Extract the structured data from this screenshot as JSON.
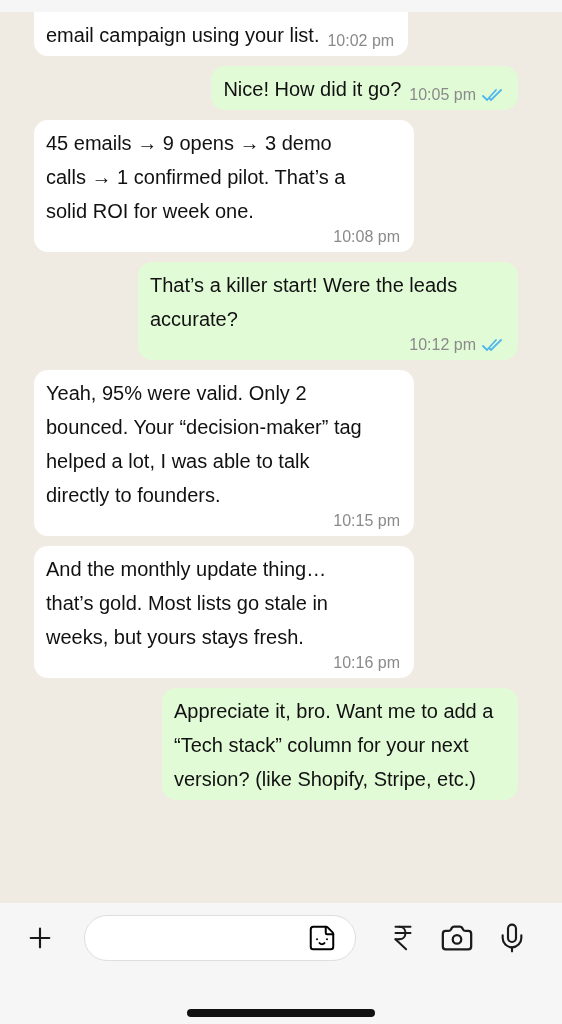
{
  "messages": [
    {
      "outgoing": false,
      "text": "email campaign using your list.",
      "time": "10:02 pm"
    },
    {
      "outgoing": true,
      "text": "Nice! How did it go?",
      "time": "10:05 pm",
      "read": true
    },
    {
      "outgoing": false,
      "text": "45 emails → 9 opens → 3 demo calls → 1 confirmed pilot. That’s a solid ROI for week one.",
      "time": "10:08 pm"
    },
    {
      "outgoing": true,
      "text": "That’s a killer start! Were the leads accurate?",
      "time": "10:12 pm",
      "read": true
    },
    {
      "outgoing": false,
      "text": "Yeah, 95% were valid. Only 2 bounced. Your “decision-maker” tag helped a lot, I was able to talk directly to founders.",
      "time": "10:15 pm"
    },
    {
      "outgoing": false,
      "text": "And the monthly update thing… that’s gold. Most lists go stale in weeks, but yours stays fresh.",
      "time": "10:16 pm"
    },
    {
      "outgoing": true,
      "text": "Appreciate it, bro. Want me to add a “Tech stack” column for your next version? (like Shopify, Stripe, etc.)"
    }
  ]
}
